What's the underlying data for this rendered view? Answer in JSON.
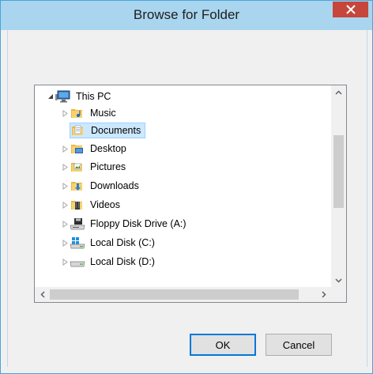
{
  "dialog": {
    "title": "Browse for Folder"
  },
  "tree": {
    "root": {
      "label": "This PC",
      "expanded": true,
      "icon": "pc-icon"
    },
    "items": [
      {
        "label": "Music",
        "icon": "music-folder-icon",
        "has_children": true
      },
      {
        "label": "Documents",
        "icon": "documents-folder-icon",
        "has_children": false,
        "selected": true
      },
      {
        "label": "Desktop",
        "icon": "desktop-folder-icon",
        "has_children": true
      },
      {
        "label": "Pictures",
        "icon": "pictures-folder-icon",
        "has_children": true
      },
      {
        "label": "Downloads",
        "icon": "downloads-folder-icon",
        "has_children": true
      },
      {
        "label": "Videos",
        "icon": "videos-folder-icon",
        "has_children": true
      },
      {
        "label": "Floppy Disk Drive (A:)",
        "icon": "floppy-drive-icon",
        "has_children": true
      },
      {
        "label": "Local Disk (C:)",
        "icon": "system-disk-icon",
        "has_children": true
      },
      {
        "label": "Local Disk (D:)",
        "icon": "hard-disk-icon",
        "has_children": true
      }
    ]
  },
  "buttons": {
    "ok": "OK",
    "cancel": "Cancel"
  },
  "colors": {
    "titlebar": "#a9d5ef",
    "close": "#c7463b",
    "selection": "#cce8ff",
    "accent": "#0078d7"
  }
}
